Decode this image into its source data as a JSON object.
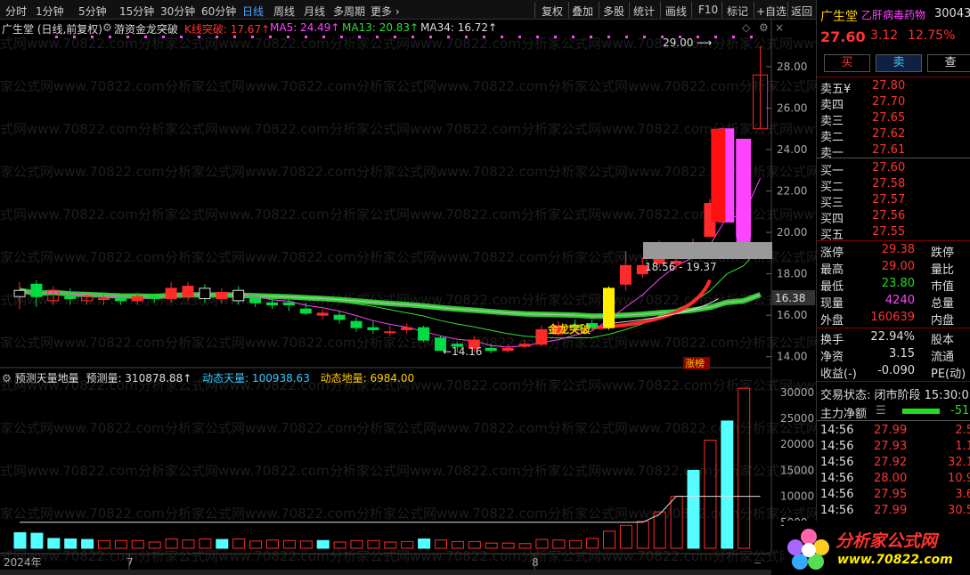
{
  "toolbar": {
    "items": [
      "分时",
      "1分钟",
      "5分钟",
      "15分钟",
      "30分钟",
      "60分钟",
      "日线",
      "周线",
      "月线",
      "多周期",
      "更多 ›"
    ],
    "right": [
      "复权",
      "叠加",
      "多股",
      "统计",
      "画线",
      "F10",
      "标记",
      "+自选",
      "返回"
    ],
    "active": "日线"
  },
  "info": {
    "stock": "广生堂 (日线,前复权)",
    "indicator": "游资金龙突破",
    "kline": "K线突破: 17.67↑",
    "ma5": "MA5: 24.49↑",
    "ma13": "MA13: 20.83↑",
    "ma34": "MA34: 16.72↑"
  },
  "vol_info": {
    "name": "预测天量地量",
    "pred": "预测量: 310878.88↑",
    "dyn_sky": "动态天量: 100938.63",
    "dyn_ground": "动态地量: 6984.00"
  },
  "price_axis": [
    "28.00",
    "26.00",
    "24.00",
    "22.00",
    "20.00",
    "18.00",
    "16.00",
    "14.00"
  ],
  "vol_axis": [
    "30000",
    "25000",
    "20000",
    "15000",
    "10000",
    "5000"
  ],
  "price_now": "16.38",
  "annotations": {
    "high": "29.00",
    "low": "←14.16",
    "range": "18.56 - 19.37",
    "zhangbang": "涨榜",
    "longtu": "金龙突破"
  },
  "xaxis": {
    "year": "2024年",
    "m7": "7",
    "m8": "8"
  },
  "watermark": "分析家公式网www.70822.com",
  "rp": {
    "name": "广生堂",
    "desc": "乙肝病毒药物",
    "code": "30043",
    "price": "27.60",
    "change": "3.12",
    "pct": "12.75%",
    "buy_btn": "买",
    "sell_btn": "卖",
    "query_btn": "查",
    "asks": [
      {
        "l": "卖五¥",
        "p": "27.80"
      },
      {
        "l": "卖四",
        "p": "27.70"
      },
      {
        "l": "卖三",
        "p": "27.65"
      },
      {
        "l": "卖二",
        "p": "27.62"
      },
      {
        "l": "卖一",
        "p": "27.61"
      }
    ],
    "bids": [
      {
        "l": "买一",
        "p": "27.60"
      },
      {
        "l": "买二",
        "p": "27.58"
      },
      {
        "l": "买三",
        "p": "27.57"
      },
      {
        "l": "买四",
        "p": "27.56"
      },
      {
        "l": "买五",
        "p": "27.55"
      }
    ],
    "stats": [
      {
        "l": "涨停",
        "v": "29.38",
        "r": "跌停"
      },
      {
        "l": "最高",
        "v": "29.00",
        "r": "量比"
      },
      {
        "l": "最低",
        "v": "23.80",
        "r": "市值"
      },
      {
        "l": "现量",
        "v": "4240",
        "r": "总量"
      },
      {
        "l": "外盘",
        "v": "160639",
        "r": "内盘"
      }
    ],
    "stats2": [
      {
        "l": "换手",
        "v": "22.94%",
        "r": "股本"
      },
      {
        "l": "净资",
        "v": "3.15",
        "r": "流通"
      },
      {
        "l": "收益(-)",
        "v": "-0.090",
        "r": "PE(动)"
      }
    ],
    "trade_status": "交易状态: 闭市阶段 15:30:0",
    "main_flow": "主力净额",
    "main_flow_val": "-51",
    "ticks": [
      {
        "t": "14:56",
        "p": "27.99",
        "v": "2.5"
      },
      {
        "t": "14:56",
        "p": "27.93",
        "v": "1.1"
      },
      {
        "t": "14:56",
        "p": "27.92",
        "v": "32.1"
      },
      {
        "t": "14:56",
        "p": "28.00",
        "v": "10.9"
      },
      {
        "t": "14:56",
        "p": "27.95",
        "v": "3.6"
      },
      {
        "t": "14:56",
        "p": "27.99",
        "v": "30.5"
      }
    ],
    "logo": "分析家公式网",
    "logo_url": "www.70822.com"
  },
  "colors": {
    "up": "#ff2a2a",
    "down": "#00dd44",
    "ma5": "#ff44ff",
    "ma13": "#33dd33",
    "ma34": "#bbbbbb",
    "yellow": "#ffee00",
    "cyan": "#55ffff"
  }
}
